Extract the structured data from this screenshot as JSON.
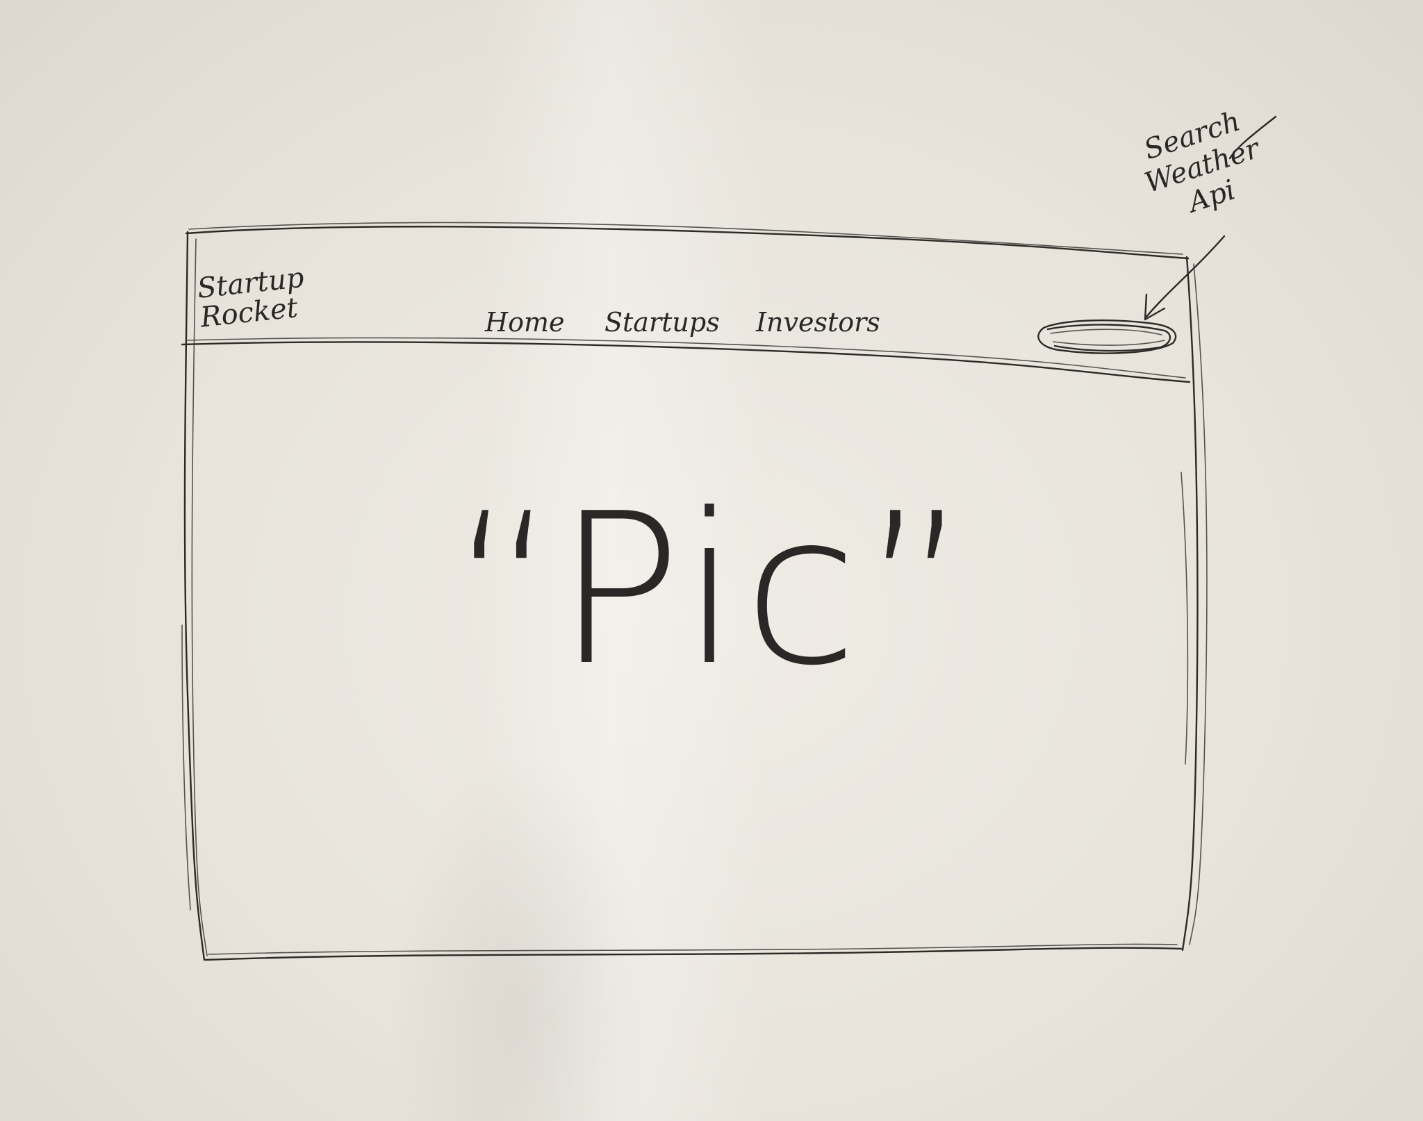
{
  "sketch": {
    "brand": "Startup Rocket",
    "nav": [
      {
        "label": "Home"
      },
      {
        "label": "Startups"
      },
      {
        "label": "Investors"
      }
    ],
    "search_annotation": "Search Weather Api",
    "placeholder_image_text": "“Pic”"
  }
}
